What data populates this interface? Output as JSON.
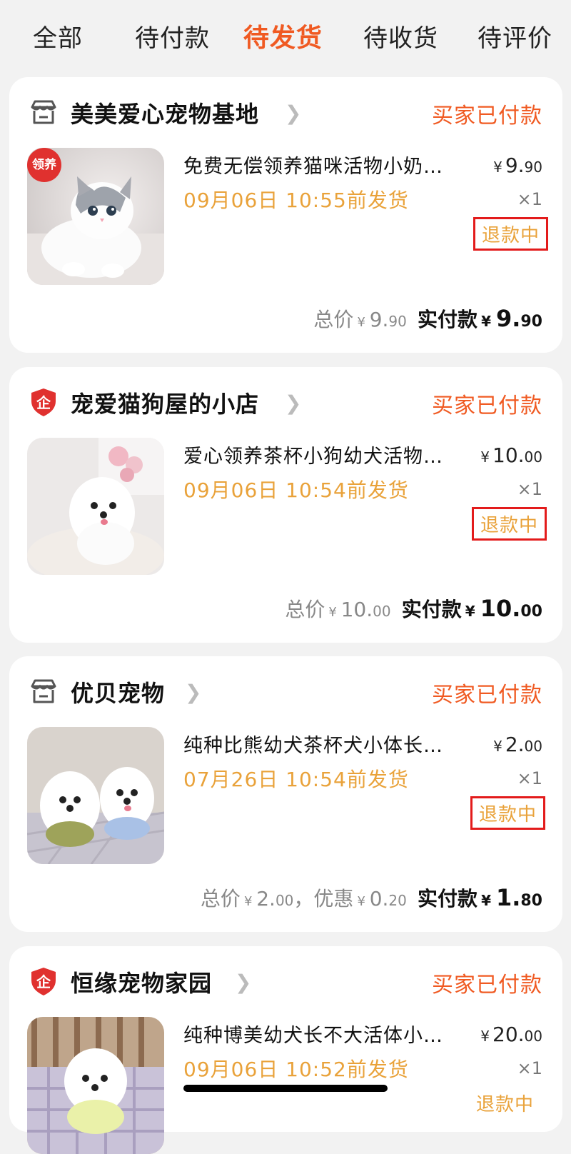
{
  "tabs": [
    "全部",
    "待付款",
    "待发货",
    "待收货",
    "待评价"
  ],
  "active_tab": 2,
  "orders": [
    {
      "store": "美美爱心宠物基地",
      "store_icon": "shop-icon",
      "status": "买家已付款",
      "badge": "领养",
      "title": "免费无偿领养猫咪活物小奶…",
      "price_yen": "¥",
      "price_int": "9.",
      "price_dec": "90",
      "ship": "09月06日 10:55前发货",
      "qty": "×1",
      "refund": "退款中",
      "total_label": "总价",
      "total_int": "9.",
      "total_dec": "90",
      "pay_label": "实付款",
      "pay_int": "9.",
      "pay_dec": "90"
    },
    {
      "store": "宠爱猫狗屋的小店",
      "store_icon": "enterprise-shield-icon",
      "status": "买家已付款",
      "title": "爱心领养茶杯小狗幼犬活物…",
      "price_yen": "¥",
      "price_int": "10.",
      "price_dec": "00",
      "ship": "09月06日 10:54前发货",
      "qty": "×1",
      "refund": "退款中",
      "total_label": "总价",
      "total_int": "10.",
      "total_dec": "00",
      "pay_label": "实付款",
      "pay_int": "10.",
      "pay_dec": "00"
    },
    {
      "store": "优贝宠物",
      "store_icon": "shop-icon",
      "status": "买家已付款",
      "title": "纯种比熊幼犬茶杯犬小体长…",
      "price_yen": "¥",
      "price_int": "2.",
      "price_dec": "00",
      "ship": "07月26日 10:54前发货",
      "qty": "×1",
      "refund": "退款中",
      "total_label": "总价",
      "total_int": "2.",
      "total_dec": "00",
      "discount_label": "，优惠",
      "discount_int": "0.",
      "discount_dec": "20",
      "pay_label": "实付款",
      "pay_int": "1.",
      "pay_dec": "80"
    },
    {
      "store": "恒缘宠物家园",
      "store_icon": "enterprise-shield-icon",
      "status": "买家已付款",
      "title": "纯种博美幼犬长不大活体小…",
      "price_yen": "¥",
      "price_int": "20.",
      "price_dec": "00",
      "ship": "09月06日 10:52前发货",
      "qty": "×1",
      "refund": "退款中"
    }
  ],
  "shield_glyph": "企",
  "colors": {
    "accent": "#f05a22",
    "ship": "#e9a23a",
    "highlight_box": "#e31b1b"
  }
}
